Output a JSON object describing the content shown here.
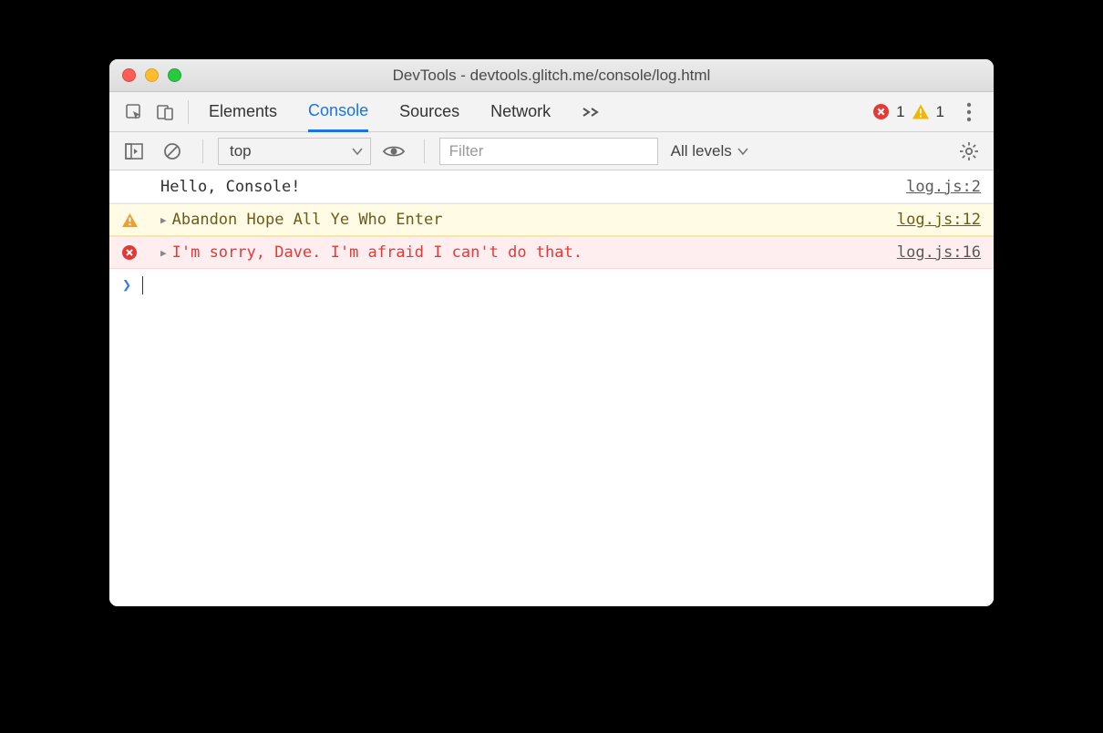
{
  "window": {
    "title": "DevTools - devtools.glitch.me/console/log.html"
  },
  "tabs": {
    "elements": "Elements",
    "console": "Console",
    "sources": "Sources",
    "network": "Network"
  },
  "badges": {
    "error_count": "1",
    "warn_count": "1"
  },
  "toolbar": {
    "context": "top",
    "filter_placeholder": "Filter",
    "levels_label": "All levels"
  },
  "messages": [
    {
      "type": "log",
      "text": "Hello, Console!",
      "source": "log.js:2"
    },
    {
      "type": "warn",
      "text": "Abandon Hope All Ye Who Enter",
      "source": "log.js:12"
    },
    {
      "type": "err",
      "text": "I'm sorry, Dave. I'm afraid I can't do that.",
      "source": "log.js:16"
    }
  ]
}
